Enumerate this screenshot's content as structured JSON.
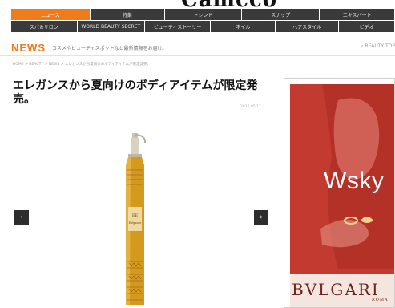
{
  "site": {
    "logo": "Camcco"
  },
  "nav": {
    "row1": [
      "ニュース",
      "特集",
      "トレンド",
      "スナップ",
      "エキスパート"
    ],
    "row2": [
      "スパ＆サロン",
      "WORLD BEAUTY SECRET",
      "ビューティストーリー",
      "ネイル",
      "ヘアスタイル",
      "ビデオ"
    ],
    "active": "ニュース"
  },
  "news_bar": {
    "title": "NEWS",
    "description": "コスメやビューティスポットなど最新情報をお届け。",
    "back_link": "‹  BEAUTY TOP"
  },
  "breadcrumb": "HOME > BEAUTY > NEWS > エレガンスから夏向けのボディアイテムが限定発売。",
  "article": {
    "headline": "エレガンスから夏向けのボディアイテムが限定発売。",
    "date": "2016.05.17",
    "product_label": "Elégance"
  },
  "gallery": {
    "prev_icon": "‹",
    "next_icon": "›"
  },
  "ad": {
    "watermark": "Wsky",
    "brand": "BVLGARI",
    "brand_sub": "ROMA"
  },
  "colors": {
    "accent": "#f07b1a",
    "nav_bg": "#3a3a3a",
    "ad_tint": "#c9352c"
  }
}
